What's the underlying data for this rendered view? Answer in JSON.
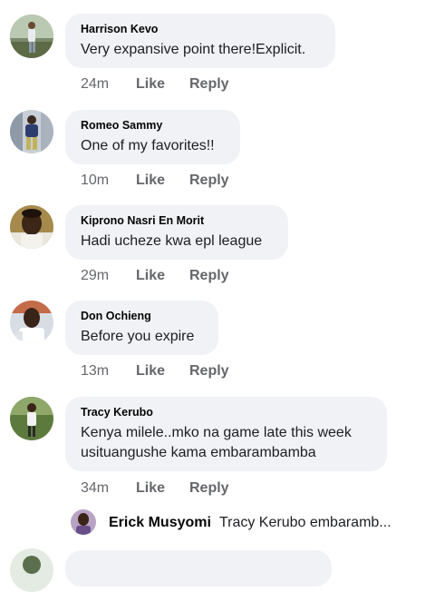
{
  "comments": [
    {
      "author": "Harrison Kevo",
      "text": "Very expansive point there!Explicit.",
      "time": "24m",
      "like": "Like",
      "reply": "Reply",
      "avatar": "person-photo-icon"
    },
    {
      "author": "Romeo Sammy",
      "text": "One of my favorites!!",
      "time": "10m",
      "like": "Like",
      "reply": "Reply",
      "avatar": "person-photo-icon"
    },
    {
      "author": "Kiprono Nasri En Morit",
      "text": "Hadi ucheze kwa epl league",
      "time": "29m",
      "like": "Like",
      "reply": "Reply",
      "avatar": "person-photo-icon"
    },
    {
      "author": "Don Ochieng",
      "text": "Before you expire",
      "time": "13m",
      "like": "Like",
      "reply": "Reply",
      "avatar": "person-photo-icon"
    },
    {
      "author": "Tracy Kerubo",
      "text": " Kenya milele..mko na game late this week\nusituangushe kama embarambamba",
      "time": "34m",
      "like": "Like",
      "reply": "Reply",
      "avatar": "person-photo-icon"
    }
  ],
  "reply_preview": {
    "author": "Erick Musyomi",
    "text": "Tracy Kerubo embaramb...",
    "avatar": "person-photo-icon"
  },
  "colors": {
    "bubble": "#f0f2f5",
    "meta": "#65676b",
    "text": "#050505"
  }
}
